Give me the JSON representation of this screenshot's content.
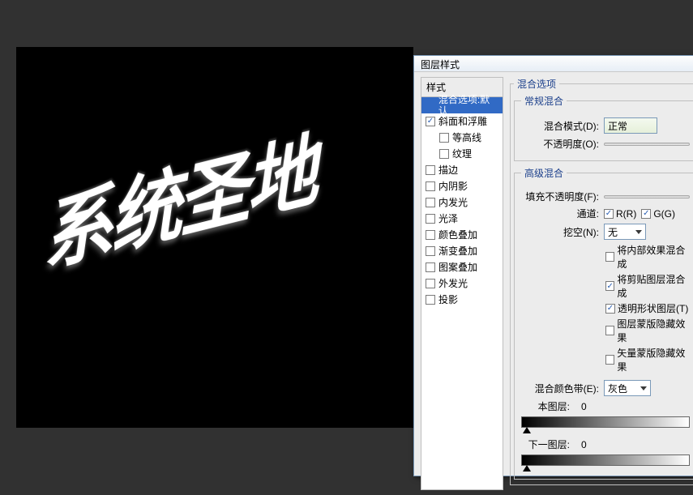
{
  "canvas": {
    "text": "系统圣地"
  },
  "dialog": {
    "title": "图层样式",
    "styles": {
      "header": "样式",
      "items": [
        {
          "label": "混合选项:默认",
          "checked": null,
          "selected": true,
          "sub": false
        },
        {
          "label": "斜面和浮雕",
          "checked": true,
          "selected": false,
          "sub": false
        },
        {
          "label": "等高线",
          "checked": false,
          "selected": false,
          "sub": true
        },
        {
          "label": "纹理",
          "checked": false,
          "selected": false,
          "sub": true
        },
        {
          "label": "描边",
          "checked": false,
          "selected": false,
          "sub": false
        },
        {
          "label": "内阴影",
          "checked": false,
          "selected": false,
          "sub": false
        },
        {
          "label": "内发光",
          "checked": false,
          "selected": false,
          "sub": false
        },
        {
          "label": "光泽",
          "checked": false,
          "selected": false,
          "sub": false
        },
        {
          "label": "颜色叠加",
          "checked": false,
          "selected": false,
          "sub": false
        },
        {
          "label": "渐变叠加",
          "checked": false,
          "selected": false,
          "sub": false
        },
        {
          "label": "图案叠加",
          "checked": false,
          "selected": false,
          "sub": false
        },
        {
          "label": "外发光",
          "checked": false,
          "selected": false,
          "sub": false
        },
        {
          "label": "投影",
          "checked": false,
          "selected": false,
          "sub": false
        }
      ]
    },
    "blend_options": {
      "group_title": "混合选项",
      "general": {
        "title": "常规混合",
        "mode_label": "混合模式(D):",
        "mode_value": "正常",
        "opacity_label": "不透明度(O):"
      },
      "advanced": {
        "title": "高级混合",
        "fill_label": "填充不透明度(F):",
        "channels_label": "通道:",
        "ch_r": "R(R)",
        "ch_g": "G(G)",
        "knockout_label": "挖空(N):",
        "knockout_value": "无",
        "opts": [
          {
            "label": "将内部效果混合成",
            "checked": false
          },
          {
            "label": "将剪贴图层混合成",
            "checked": true
          },
          {
            "label": "透明形状图层(T)",
            "checked": true
          },
          {
            "label": "图层蒙版隐藏效果",
            "checked": false
          },
          {
            "label": "矢量蒙版隐藏效果",
            "checked": false
          }
        ],
        "blendif_label": "混合颜色带(E):",
        "blendif_value": "灰色",
        "this_layer_label": "本图层:",
        "this_layer_val": "0",
        "under_layer_label": "下一图层:",
        "under_layer_val": "0"
      }
    }
  }
}
